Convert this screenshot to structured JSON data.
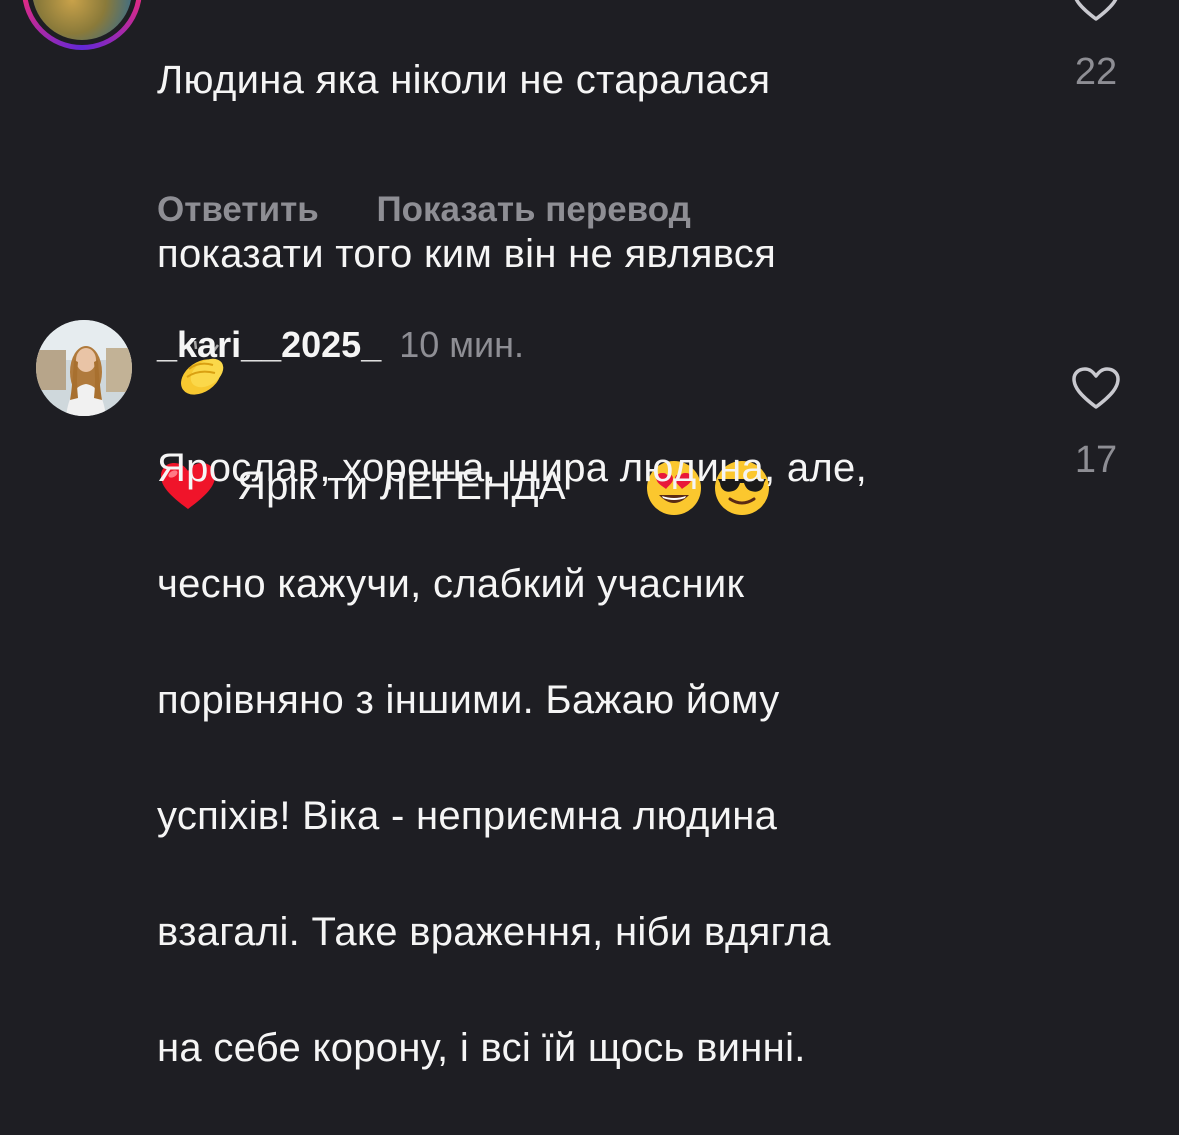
{
  "comments": [
    {
      "text_lines": [
        "Людина яка ніколи не старалася",
        "показати того ким він не являвся"
      ],
      "text_line3": "Ярік ти ЛЕГЕНДА",
      "emojis": [
        "clapping-hands",
        "red-heart",
        "heart-eyes",
        "sunglasses-face"
      ],
      "actions": {
        "reply": "Ответить",
        "translate": "Показать перевод"
      },
      "likes": "22"
    },
    {
      "username": "_kari__2025_",
      "time": "10 мин.",
      "text_lines": [
        "Ярослав, хороша, щира людина, але,",
        "чесно кажучи, слабкий учасник",
        "порівняно з іншими. Бажаю йому",
        "успіхів! Віка - неприємна людина",
        "взагалі. Таке враження, ніби вдягла",
        "на себе корону, і всі їй щось винні."
      ],
      "likes": "17"
    }
  ],
  "colors": {
    "background": "#1e1e23",
    "text": "#f5f5f5",
    "muted": "#8e8e94"
  }
}
